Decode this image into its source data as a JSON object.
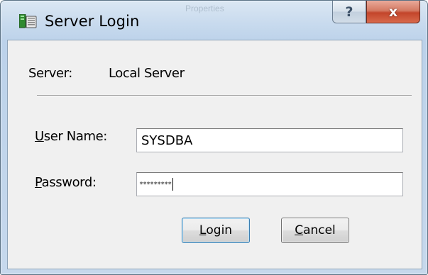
{
  "window": {
    "title": "Server Login",
    "background_title": "Properties",
    "help_glyph": "?",
    "close_glyph": "x"
  },
  "server": {
    "label": "Server:",
    "value": "Local Server"
  },
  "user_name": {
    "label_accel": "U",
    "label_rest": "ser Name:",
    "value": "SYSDBA"
  },
  "password": {
    "label_accel": "P",
    "label_rest": "assword:",
    "masked_value": "*********"
  },
  "buttons": {
    "login_accel": "L",
    "login_rest": "ogin",
    "cancel_accel": "C",
    "cancel_rest": "ancel"
  },
  "colors": {
    "frame": "#c6d8ec",
    "client": "#f0f0f0",
    "close_button": "#c3452b",
    "default_button_border": "#3c7fb1"
  },
  "icons": {
    "app": "server-database-icon"
  }
}
